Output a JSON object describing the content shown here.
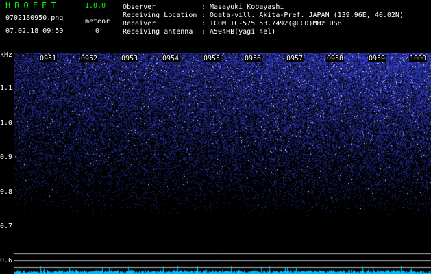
{
  "header": {
    "app_title": "HROFFT",
    "app_version": "1.0.0",
    "file_name": "0702180950.png",
    "date_time": "07.02.18 09:50",
    "meteor_label": "meteor",
    "meteor_count": "0"
  },
  "info": [
    {
      "key": "Observer",
      "value": "Masayuki Kobayashi"
    },
    {
      "key": "Receiving Location",
      "value": "Ogata-vill. Akita-Pref. JAPAN (139.96E, 40.02N)"
    },
    {
      "key": "Receiver",
      "value": "ICOM IC-575 53.7492(@LCD)MHz USB"
    },
    {
      "key": "Receiving antenna",
      "value": "A504HB(yagi 4el)"
    }
  ],
  "separator": ":",
  "chart_data": {
    "type": "heatmap",
    "ylabel": "kHz",
    "y_ticks": [
      "1.1",
      "1.0",
      "0.9",
      "0.8",
      "0.7",
      "0.6"
    ],
    "y_tick_values": [
      1.1,
      1.0,
      0.9,
      0.8,
      0.7,
      0.6
    ],
    "ylim": [
      0.58,
      1.2
    ],
    "x_ticks": [
      "0951",
      "0952",
      "0953",
      "0954",
      "0955",
      "0956",
      "0957",
      "0958",
      "0959",
      "1000"
    ],
    "colors": {
      "background": "#000000",
      "noise": "#3a4cff",
      "grid_vertical": "#ffffff",
      "grid_horizontal": "#b4b4b4",
      "signal_trace": "#00c0ff"
    }
  }
}
